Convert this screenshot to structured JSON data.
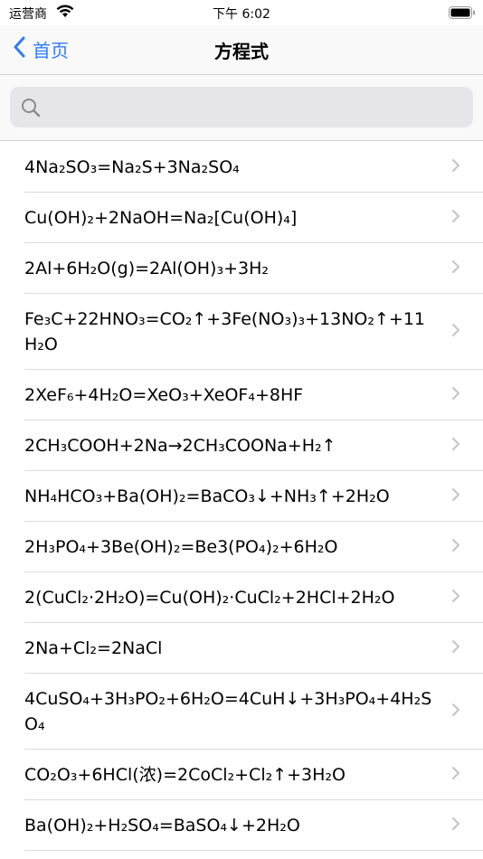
{
  "status_bar": {
    "carrier": "运营商",
    "time": "下午 6:02"
  },
  "nav": {
    "back_label": "首页",
    "title": "方程式"
  },
  "search": {
    "placeholder": ""
  },
  "equations": [
    "4Na₂SO₃=Na₂S+3Na₂SO₄",
    "Cu(OH)₂+2NaOH=Na₂[Cu(OH)₄]",
    "2Al+6H₂O(g)=2Al(OH)₃+3H₂",
    "Fe₃C+22HNO₃=CO₂↑+3Fe(NO₃)₃+13NO₂↑+11H₂O",
    "2XeF₆+4H₂O=XeO₃+XeOF₄+8HF",
    "2CH₃COOH+2Na→2CH₃COONa+H₂↑",
    "NH₄HCO₃+Ba(OH)₂=BaCO₃↓+NH₃↑+2H₂O",
    "2H₃PO₄+3Be(OH)₂=Be3(PO₄)₂+6H₂O",
    "2(CuCl₂·2H₂O)=Cu(OH)₂·CuCl₂+2HCl+2H₂O",
    "2Na+Cl₂=2NaCl",
    "4CuSO₄+3H₃PO₂+6H₂O=4CuH↓+3H₃PO₄+4H₂SO₄",
    "CO₂O₃+6HCl(浓)=2CoCl₂+Cl₂↑+3H₂O",
    "Ba(OH)₂+H₂SO₄=BaSO₄↓+2H₂O"
  ],
  "colors": {
    "accent": "#2f7cf6",
    "chevron": "#c4c4c7"
  }
}
